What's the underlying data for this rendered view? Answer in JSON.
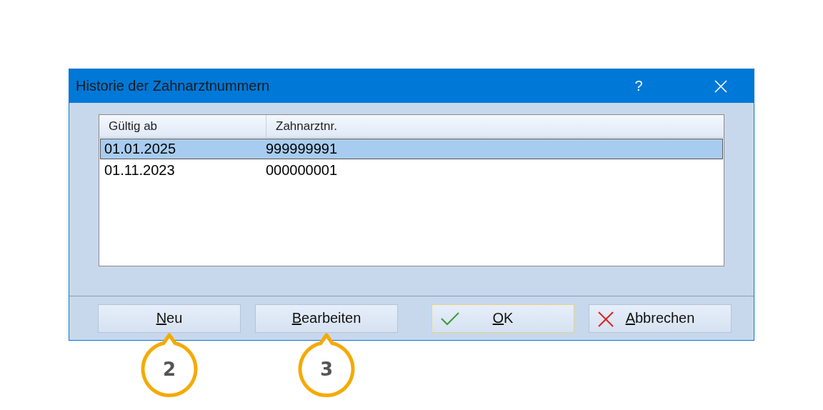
{
  "window": {
    "title": "Historie der Zahnarztnummern",
    "help_button": "?"
  },
  "table": {
    "columns": [
      "Gültig ab",
      "Zahnarztnr."
    ],
    "rows": [
      {
        "cells": [
          "01.01.2025",
          "999999991"
        ],
        "selected": true
      },
      {
        "cells": [
          "01.11.2023",
          "000000001"
        ],
        "selected": false
      }
    ]
  },
  "buttons": [
    {
      "label": "Neu",
      "kind": "plain",
      "mnemonic": true,
      "default": false,
      "callout": "2"
    },
    {
      "label": "Bearbeiten",
      "kind": "plain",
      "mnemonic": true,
      "default": false,
      "callout": "3"
    },
    {
      "label": "OK",
      "kind": "ok",
      "mnemonic": true,
      "default": true
    },
    {
      "label": "Abbrechen",
      "kind": "cancel",
      "mnemonic": true,
      "default": false
    }
  ]
}
